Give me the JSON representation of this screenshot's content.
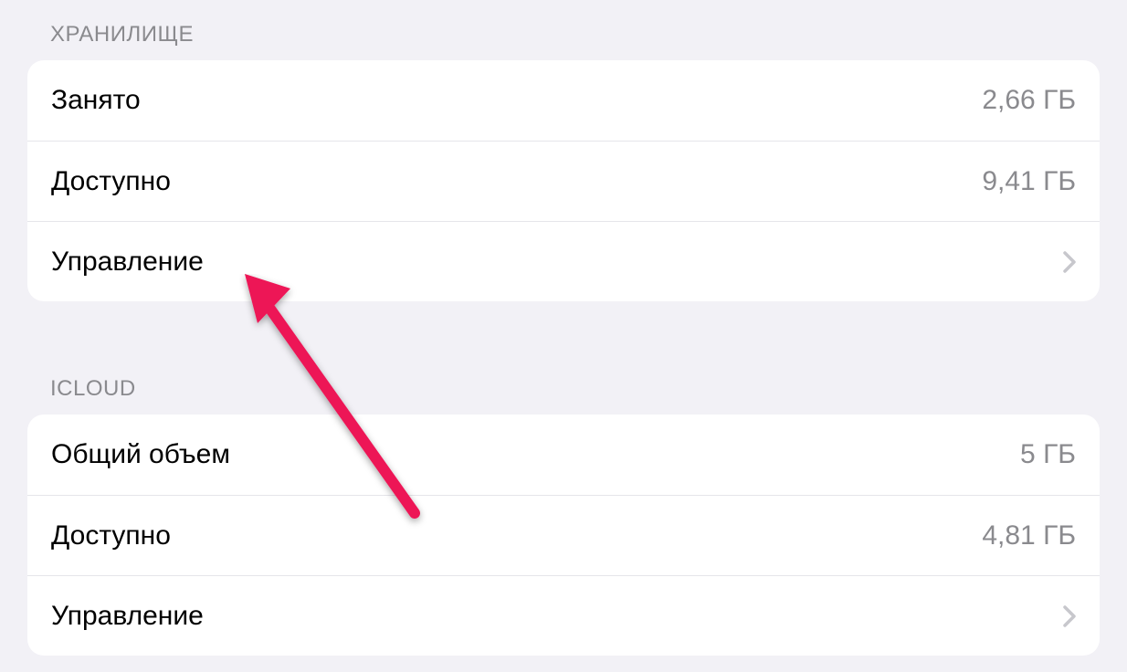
{
  "storage": {
    "header": "Хранилище",
    "used_label": "Занято",
    "used_value": "2,66 ГБ",
    "available_label": "Доступно",
    "available_value": "9,41 ГБ",
    "manage_label": "Управление"
  },
  "icloud": {
    "header": "iCloud",
    "total_label": "Общий объем",
    "total_value": "5 ГБ",
    "available_label": "Доступно",
    "available_value": "4,81 ГБ",
    "manage_label": "Управление"
  },
  "colors": {
    "arrow": "#ed1556"
  }
}
